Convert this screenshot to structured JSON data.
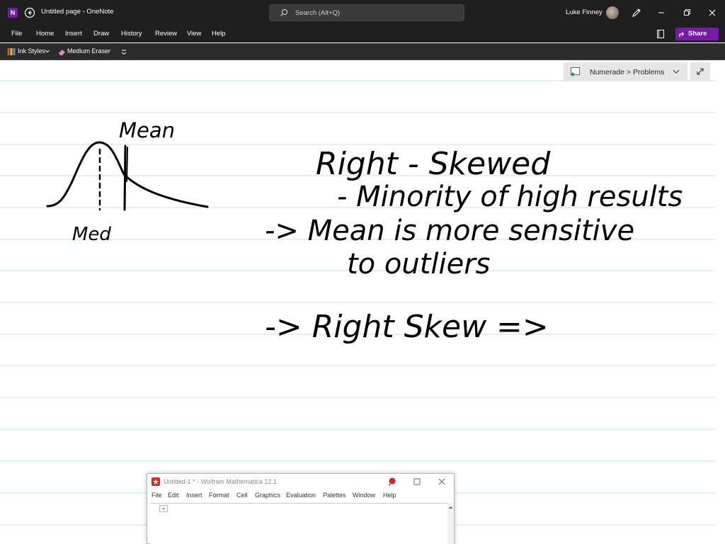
{
  "titlebar": {
    "title": "Untitled page  -  OneNote",
    "search_placeholder": "Search (Alt+Q)",
    "user_name": "Luke Finney"
  },
  "menu": {
    "items": [
      "File",
      "Home",
      "Insert",
      "Draw",
      "History",
      "Review",
      "View",
      "Help"
    ],
    "share_label": "Share"
  },
  "ribbon": {
    "ink_styles": "Ink Styles",
    "eraser": "Medium Eraser"
  },
  "page": {
    "breadcrumb": "Numerade > Problems",
    "notes": {
      "mean_label": "Mean",
      "median_label": "Med",
      "line1": "Right - Skewed",
      "line2": "- Minority of high results",
      "line3": "-> Mean is more sensitive",
      "line4": "to outliers",
      "line5": "-> Right Skew =>"
    }
  },
  "mathematica": {
    "title": "Untitled-1 * - Wolfram Mathematica 12.1",
    "menu": [
      "File",
      "Edit",
      "Insert",
      "Format",
      "Cell",
      "Graphics",
      "Evaluation",
      "Palettes",
      "Window",
      "Help"
    ]
  },
  "colors": {
    "titlebar_bg": "#1f1f1f",
    "ribbon_bg": "#2b2b2b",
    "accent_purple": "#7719aa",
    "rule_line": "#bfe3f0",
    "ink": "#000000"
  }
}
